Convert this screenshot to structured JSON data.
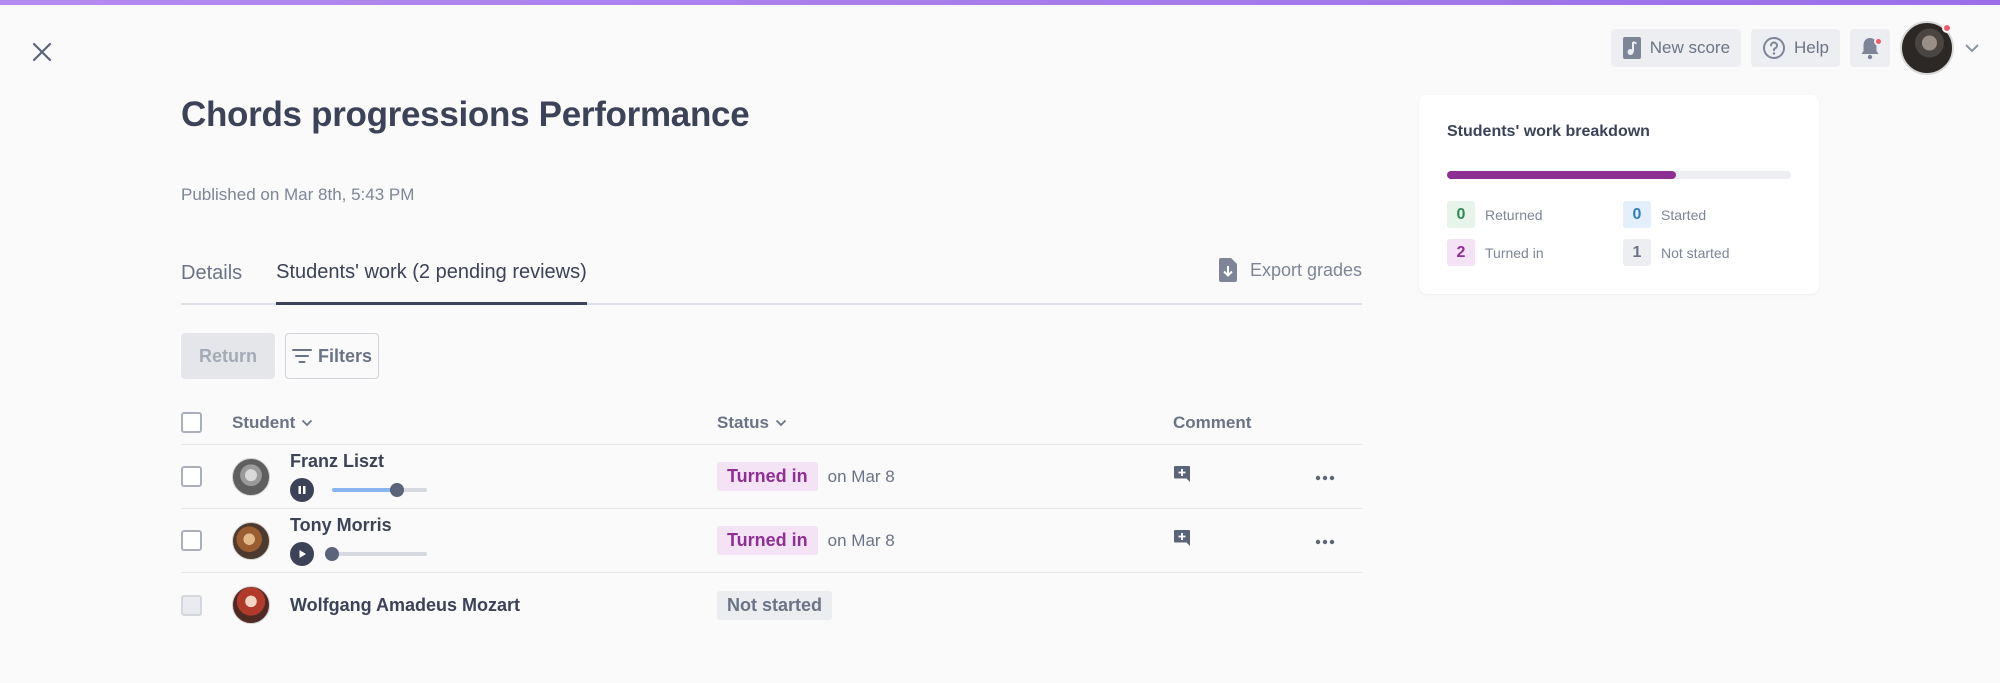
{
  "header": {
    "new_score_label": "New score",
    "help_label": "Help",
    "has_notifications": true
  },
  "page": {
    "title": "Chords progressions Performance",
    "published": "Published on Mar 8th, 5:43 PM"
  },
  "tabs": [
    {
      "label": "Details",
      "active": false
    },
    {
      "label": "Students' work (2 pending reviews)",
      "active": true
    }
  ],
  "export_label": "Export grades",
  "toolbar": {
    "return_label": "Return",
    "filters_label": "Filters"
  },
  "table": {
    "headers": {
      "student": "Student",
      "status": "Status",
      "comment": "Comment"
    },
    "rows": [
      {
        "name": "Franz Liszt",
        "status": "Turned in",
        "date": "on Mar 8",
        "audio_progress": 0.68,
        "playing": true
      },
      {
        "name": "Tony Morris",
        "status": "Turned in",
        "date": "on Mar 8",
        "audio_progress": 0.0,
        "playing": false
      },
      {
        "name": "Wolfgang Amadeus Mozart",
        "status": "Not started",
        "date": ""
      }
    ]
  },
  "breakdown": {
    "title": "Students' work breakdown",
    "progress_fraction": 0.667,
    "items": [
      {
        "count": "0",
        "label": "Returned"
      },
      {
        "count": "0",
        "label": "Started"
      },
      {
        "count": "2",
        "label": "Turned in"
      },
      {
        "count": "1",
        "label": "Not started"
      }
    ]
  },
  "colors": {
    "accent": "#8e2f93",
    "top_bar": "#9b6ee8",
    "text": "#3c4257"
  }
}
